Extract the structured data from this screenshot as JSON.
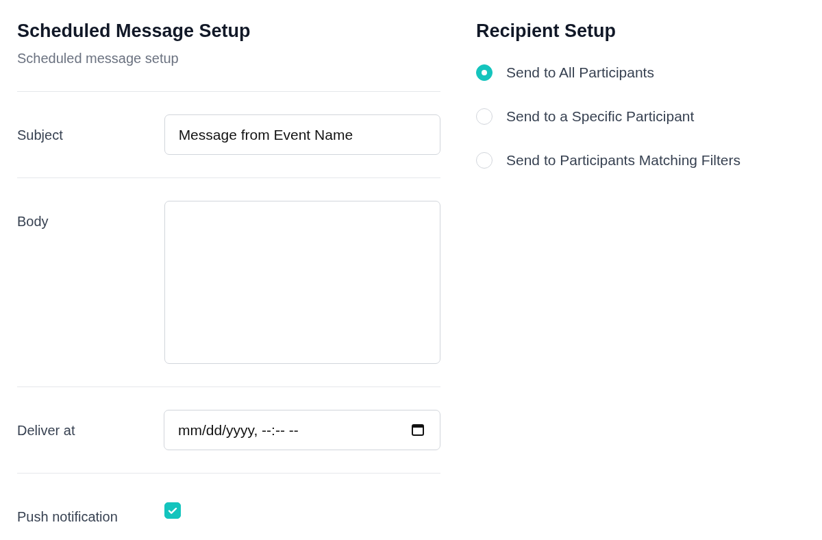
{
  "form": {
    "title": "Scheduled Message Setup",
    "subtitle": "Scheduled message setup",
    "fields": [
      {
        "kind": "text",
        "label": "Subject",
        "value": "Message from Event Name"
      },
      {
        "kind": "textarea",
        "label": "Body"
      },
      {
        "kind": "datetime",
        "label": "Deliver at",
        "placeholder": "mm/dd/yyyy, --:-- --"
      },
      {
        "kind": "checkbox",
        "label": "Push notification",
        "checked": true
      }
    ]
  },
  "recipients": {
    "title": "Recipient Setup",
    "options": [
      {
        "label": "Send to All Participants",
        "selected": true
      },
      {
        "label": "Send to a Specific Participant",
        "selected": false
      },
      {
        "label": "Send to Participants Matching Filters",
        "selected": false
      }
    ]
  }
}
